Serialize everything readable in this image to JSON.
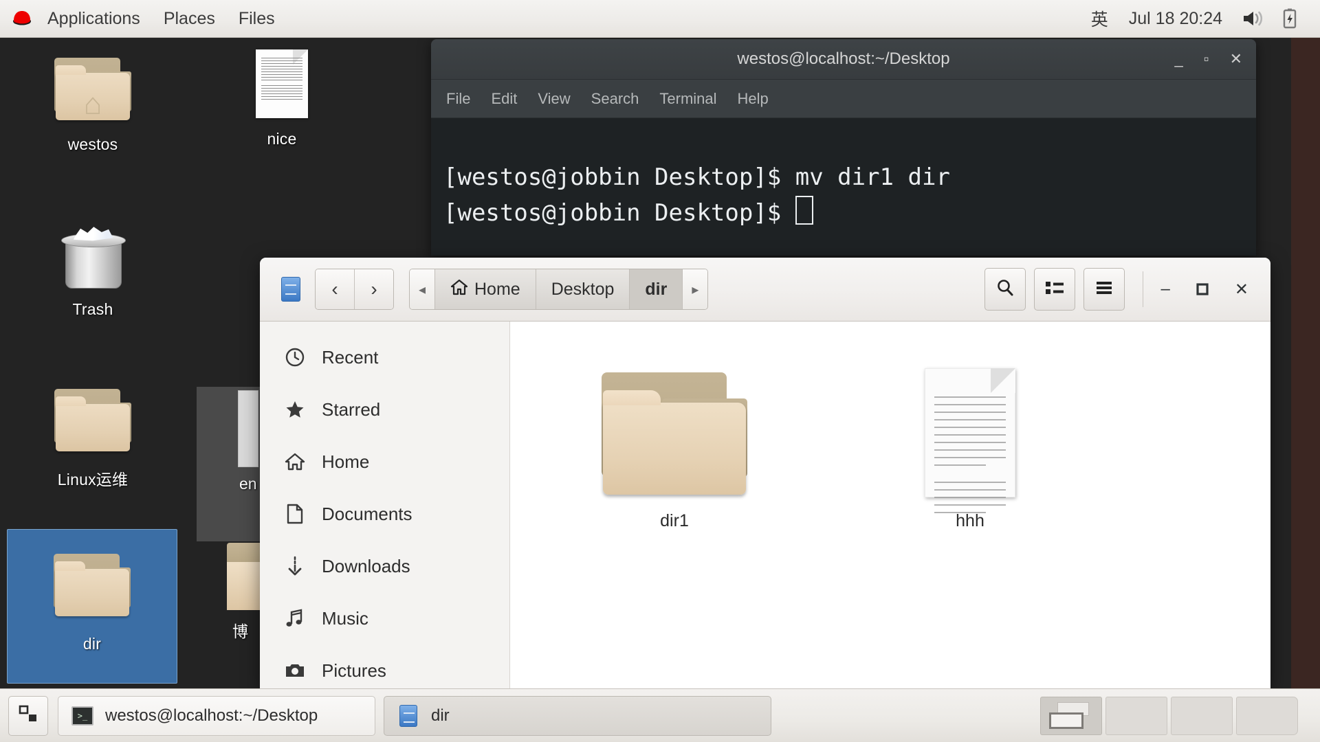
{
  "topbar": {
    "logo_icon": "redhat-logo-icon",
    "menus": [
      {
        "label": "Applications"
      },
      {
        "label": "Places"
      },
      {
        "label": "Files"
      }
    ],
    "ime": "英",
    "clock": "Jul 18  20:24",
    "volume_icon": "volume-icon",
    "battery_icon": "battery-charging-icon"
  },
  "desktop": {
    "icons": [
      {
        "label": "westos",
        "type": "home-folder"
      },
      {
        "label": "nice",
        "type": "text-document"
      },
      {
        "label": "Trash",
        "type": "trash"
      },
      {
        "label": "Linux运维",
        "type": "folder"
      },
      {
        "label": "dir",
        "type": "folder",
        "selected": true
      },
      {
        "label": "en",
        "type": "partial"
      },
      {
        "label": "博",
        "type": "partial-folder"
      }
    ]
  },
  "terminal": {
    "title": "westos@localhost:~/Desktop",
    "menu": [
      "File",
      "Edit",
      "View",
      "Search",
      "Terminal",
      "Help"
    ],
    "controls": {
      "minimize": "_",
      "maximize": "▫",
      "close": "✕"
    },
    "lines": [
      "[westos@jobbin Desktop]$ mv dir1 dir",
      "[westos@jobbin Desktop]$ "
    ]
  },
  "filemanager": {
    "app_icon": "file-cabinet-icon",
    "nav": {
      "back": "‹",
      "forward": "›"
    },
    "breadcrumb": {
      "left_arrow": "◂",
      "right_arrow": "▸",
      "items": [
        {
          "label": "Home",
          "icon": "home-icon",
          "current": false
        },
        {
          "label": "Desktop",
          "icon": "",
          "current": false
        },
        {
          "label": "dir",
          "icon": "",
          "current": true
        }
      ]
    },
    "tools": [
      {
        "name": "search-button",
        "icon": "search-icon"
      },
      {
        "name": "view-list-button",
        "icon": "list-view-icon"
      },
      {
        "name": "menu-button",
        "icon": "hamburger-menu-icon"
      }
    ],
    "window_controls": {
      "minimize": "–",
      "maximize": "▫",
      "close": "✕"
    },
    "sidebar": [
      {
        "label": "Recent",
        "icon": "clock-icon"
      },
      {
        "label": "Starred",
        "icon": "star-icon"
      },
      {
        "label": "Home",
        "icon": "home-icon"
      },
      {
        "label": "Documents",
        "icon": "document-icon"
      },
      {
        "label": "Downloads",
        "icon": "download-icon"
      },
      {
        "label": "Music",
        "icon": "music-note-icon"
      },
      {
        "label": "Pictures",
        "icon": "camera-icon"
      }
    ],
    "files": [
      {
        "label": "dir1",
        "type": "folder"
      },
      {
        "label": "hhh",
        "type": "text-document"
      }
    ]
  },
  "taskbar": {
    "show_desktop_icon": "show-desktop-icon",
    "tasks": [
      {
        "label": "westos@localhost:~/Desktop",
        "icon": "terminal-icon",
        "active": false
      },
      {
        "label": "dir",
        "icon": "file-cabinet-icon",
        "active": true
      }
    ],
    "workspaces": [
      {
        "index": "1",
        "active": true
      },
      {
        "index": "2",
        "active": false
      },
      {
        "index": "3",
        "active": false
      },
      {
        "index": "4",
        "active": false
      }
    ]
  },
  "colors": {
    "desktop": "#232323",
    "desktop_right": "#3b2622",
    "selection": "#3b6ea5",
    "terminal_bg": "#1e2224"
  }
}
